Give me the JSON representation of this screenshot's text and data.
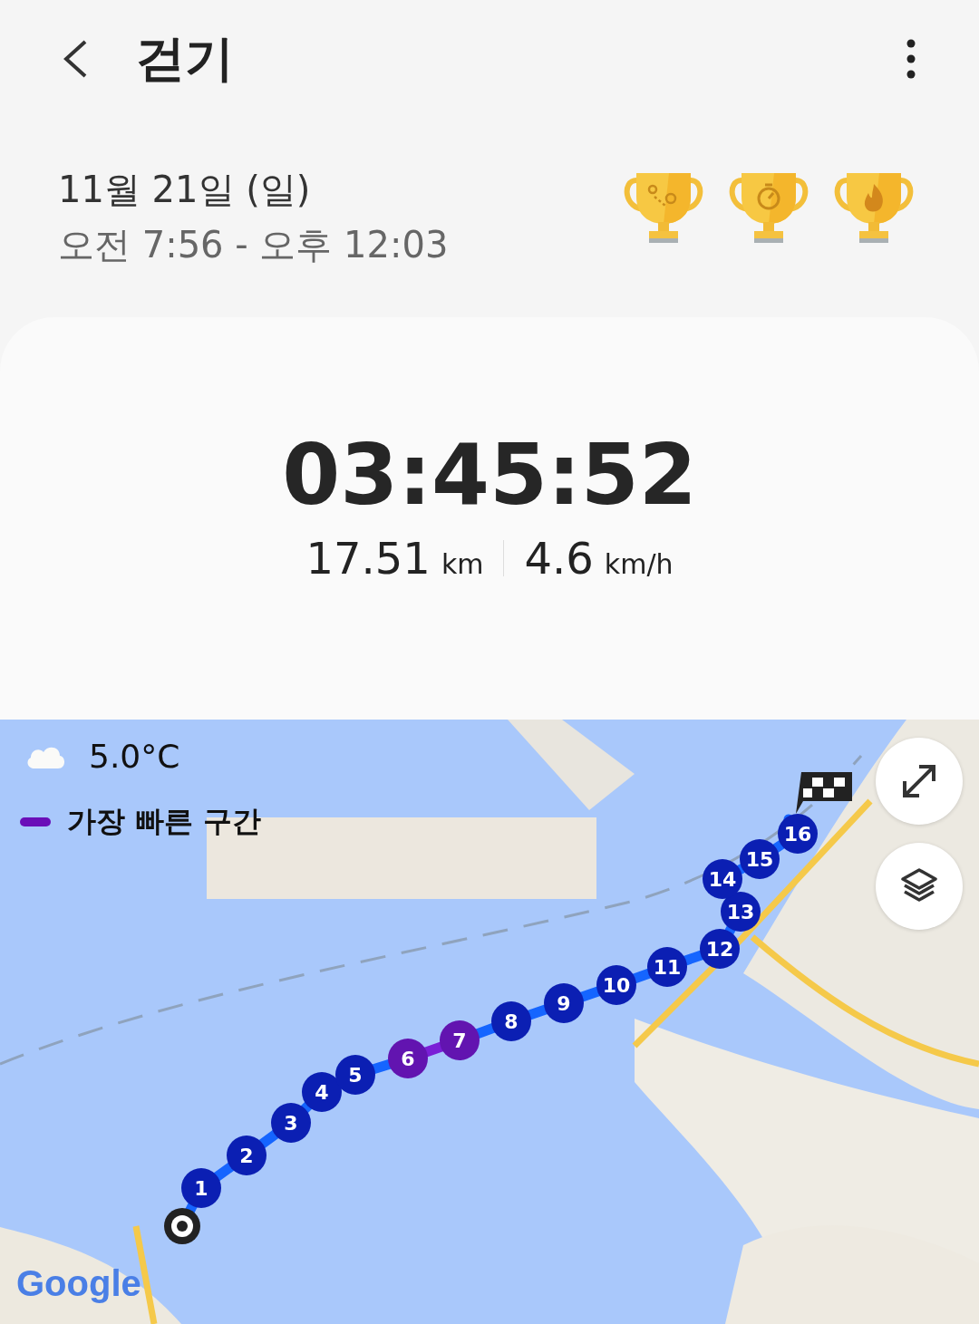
{
  "header": {
    "title": "걷기"
  },
  "session": {
    "date": "11월 21일 (일)",
    "time_range": "오전 7:56 - 오후 12:03"
  },
  "trophies": [
    {
      "kind": "route"
    },
    {
      "kind": "stopwatch"
    },
    {
      "kind": "flame"
    }
  ],
  "summary": {
    "duration": "03:45:52",
    "distance": "17.51",
    "distance_unit": "km",
    "speed": "4.6",
    "speed_unit": "km/h"
  },
  "map": {
    "temperature": "5.0°C",
    "legend": "가장 빠른 구간",
    "logo": "Google",
    "markers": [
      {
        "label": "1",
        "fastest": false
      },
      {
        "label": "2",
        "fastest": false
      },
      {
        "label": "3",
        "fastest": false
      },
      {
        "label": "4",
        "fastest": false
      },
      {
        "label": "5",
        "fastest": false
      },
      {
        "label": "6",
        "fastest": true
      },
      {
        "label": "7",
        "fastest": true
      },
      {
        "label": "8",
        "fastest": false
      },
      {
        "label": "9",
        "fastest": false
      },
      {
        "label": "10",
        "fastest": false
      },
      {
        "label": "11",
        "fastest": false
      },
      {
        "label": "12",
        "fastest": false
      },
      {
        "label": "13",
        "fastest": false
      },
      {
        "label": "14",
        "fastest": false
      },
      {
        "label": "15",
        "fastest": false
      },
      {
        "label": "16",
        "fastest": false
      }
    ]
  }
}
